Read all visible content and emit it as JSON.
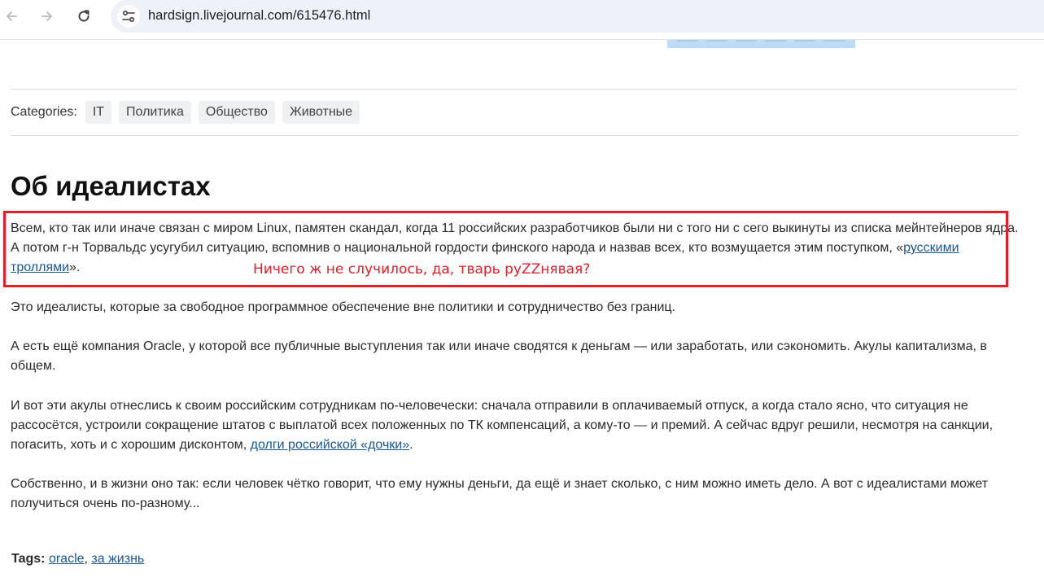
{
  "browser": {
    "url": "hardsign.livejournal.com/615476.html",
    "back_icon": "arrow-left-icon",
    "forward_icon": "arrow-right-icon",
    "reload_icon": "reload-icon",
    "site_info_icon": "tune-icon"
  },
  "categories": {
    "label": "Categories:",
    "items": [
      "IT",
      "Политика",
      "Общество",
      "Животные"
    ]
  },
  "post": {
    "title": "Об идеалистах",
    "p1_text": "Всем, кто так или иначе связан с миром Linux, памятен скандал, когда 11 российских разработчиков были ни с того ни с сего выкинуты из списка мейнтейнеров ядра. А потом г-н Торвальдс усугубил ситуацию, вспомнив о национальной гордости финского народа и назвав всех, кто возмущается этим поступком, «",
    "p1_link": "русскими троллями",
    "p1_end": "».",
    "annotation": "Ничего ж не случилось, да, тварь руZZнявая?",
    "p2": "Это идеалисты, которые за свободное программное обеспечение вне политики и сотрудничество без границ.",
    "p3": "А есть ещё компания Oracle, у которой все публичные выступления так или иначе сводятся к деньгам — или заработать, или сэкономить. Акулы капитализма, в общем.",
    "p4_text": "И вот эти акулы отнеслись к своим российским сотрудникам по-человечески: сначала отправили в оплачиваемый отпуск, а когда стало ясно, что ситуация не рассосётся, устроили сокращение штатов с выплатой всех положенных по ТК компенсаций, а кому-то — и премий. А сейчас вдруг решили, несмотря на санкции, погасить, хоть и с хорошим дисконтом, ",
    "p4_link": "долги российской «дочки»",
    "p4_end": ".",
    "p5": "Собственно, и в жизни оно так: если человек чётко говорит, что ему нужны деньги, да ещё и знает сколько, с ним можно иметь дело. А вот с идеалистами может получиться очень по-разному..."
  },
  "tags": {
    "label": "Tags:",
    "items": [
      "oracle",
      "за жизнь"
    ],
    "separator": ", "
  },
  "colors": {
    "annotation_red": "#e0202b",
    "link_blue": "#1a5594",
    "omnibox_bg": "#eef1f8"
  }
}
